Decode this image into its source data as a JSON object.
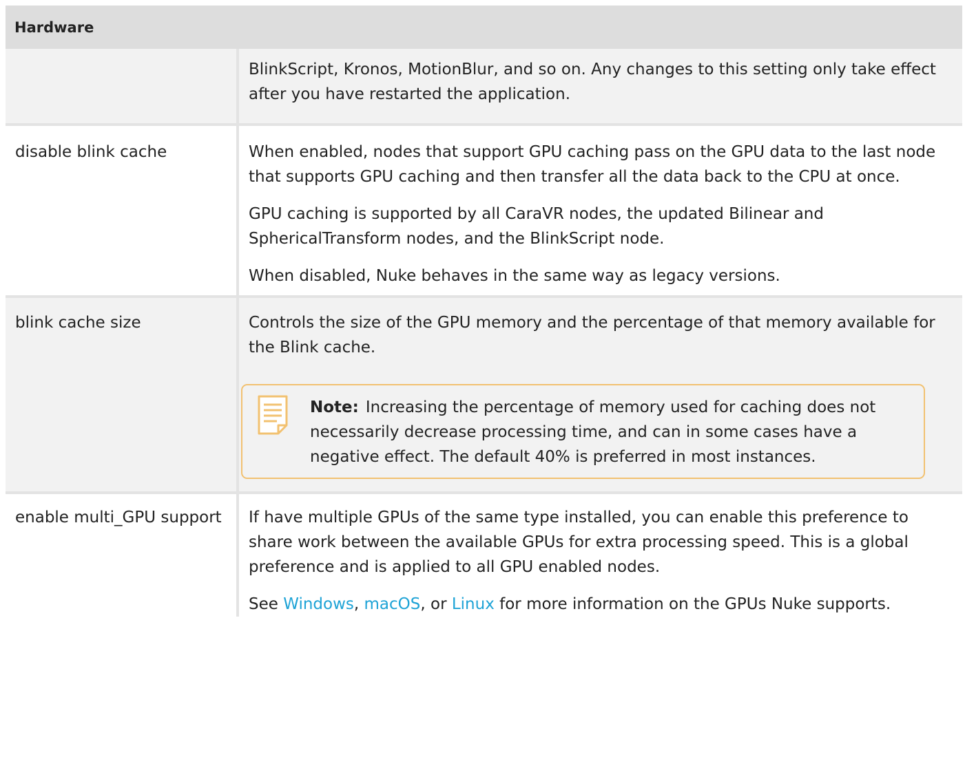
{
  "table": {
    "header": "Hardware",
    "rows": [
      {
        "name": "",
        "paragraphs": [
          "BlinkScript, Kronos, MotionBlur, and so on. Any changes to this setting only take effect after you have restarted the application."
        ]
      },
      {
        "name": "disable blink cache",
        "paragraphs": [
          "When enabled, nodes that support GPU caching pass on the GPU data to the last node that supports GPU caching and then transfer all the data back to the CPU at once.",
          "GPU caching is supported by all CaraVR nodes, the updated Bilinear and SphericalTransform nodes, and the BlinkScript node.",
          "When disabled, Nuke behaves in the same way as legacy versions."
        ]
      },
      {
        "name": "blink cache size",
        "paragraphs": [
          "Controls the size of the GPU memory and the percentage of that memory available for the Blink cache."
        ],
        "note": {
          "label": "Note:",
          "text": "Increasing the percentage of memory used for caching does not necessarily decrease processing time, and can in some cases have a negative effect. The default 40% is preferred in most instances."
        }
      },
      {
        "name": "enable multi_GPU support",
        "paragraphs": [
          "If have multiple GPUs of the same type installed, you can enable this preference to share work between the available GPUs for extra processing speed. This is a global preference and is applied to all GPU enabled nodes."
        ],
        "links_paragraph": {
          "prefix": "See ",
          "link1": "Windows",
          "sep1": ", ",
          "link2": "macOS",
          "sep2": ", or ",
          "link3": "Linux",
          "suffix": " for more information on the GPUs Nuke supports."
        }
      }
    ]
  },
  "icons": {
    "note": "note-icon"
  },
  "colors": {
    "header_bg": "#dddddd",
    "shaded_row_bg": "#f2f2f2",
    "note_border": "#f2c170",
    "link": "#1ea3d6"
  }
}
